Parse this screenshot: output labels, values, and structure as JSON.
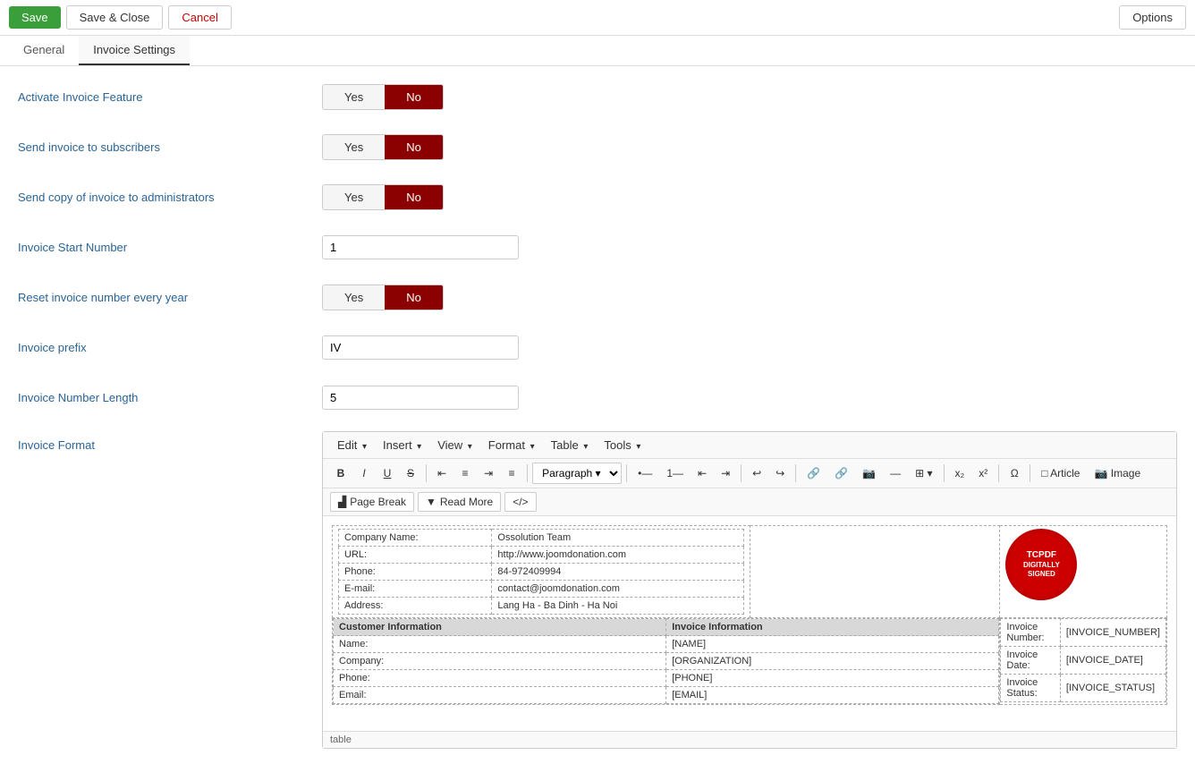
{
  "topbar": {
    "save_label": "Save",
    "save_close_label": "Save & Close",
    "cancel_label": "Cancel",
    "options_label": "Options"
  },
  "tabs": [
    {
      "id": "general",
      "label": "General"
    },
    {
      "id": "invoice_settings",
      "label": "Invoice Settings",
      "active": true
    }
  ],
  "fields": {
    "activate_invoice": {
      "label": "Activate Invoice Feature",
      "yes": "Yes",
      "no": "No",
      "value": "no"
    },
    "send_invoice_subscribers": {
      "label": "Send invoice to subscribers",
      "yes": "Yes",
      "no": "No",
      "value": "no"
    },
    "send_copy_admin": {
      "label": "Send copy of invoice to administrators",
      "yes": "Yes",
      "no": "No",
      "value": "no"
    },
    "invoice_start_number": {
      "label": "Invoice Start Number",
      "value": "1"
    },
    "reset_invoice_number": {
      "label": "Reset invoice number every year",
      "yes": "Yes",
      "no": "No",
      "value": "no"
    },
    "invoice_prefix": {
      "label": "Invoice prefix",
      "value": "IV"
    },
    "invoice_number_length": {
      "label": "Invoice Number Length",
      "value": "5"
    },
    "invoice_format": {
      "label": "Invoice Format"
    }
  },
  "editor": {
    "menus": [
      "Edit",
      "Insert",
      "View",
      "Format",
      "Table",
      "Tools"
    ],
    "toolbar": {
      "bold": "B",
      "italic": "I",
      "underline": "U",
      "strikethrough": "S",
      "align_left": "≡",
      "align_center": "≡",
      "align_right": "≡",
      "align_justify": "≡",
      "paragraph_label": "Paragraph",
      "bullet_list": "•",
      "numbered_list": "#",
      "decrease_indent": "◁",
      "increase_indent": "▷",
      "undo": "↩",
      "redo": "↪",
      "link": "🔗",
      "unlink": "🔗",
      "image": "🖼",
      "hr": "—",
      "table_icon": "⊞",
      "subscript": "x₂",
      "superscript": "x²",
      "special_char": "Ω",
      "article_label": "Article",
      "image_label": "Image"
    },
    "toolbar2": {
      "page_break_label": "Page Break",
      "read_more_label": "Read More",
      "source_label": "</>"
    },
    "invoice_content": {
      "company_name_label": "Company Name:",
      "company_name_value": "Ossolution Team",
      "url_label": "URL:",
      "url_value": "http://www.joomdonation.com",
      "phone_label": "Phone:",
      "phone_value": "84-972409994",
      "email_label": "E-mail:",
      "email_value": "contact@joomdonation.com",
      "address_label": "Address:",
      "address_value": "Lang Ha - Ba Dinh - Ha Noi",
      "logo_line1": "TCPDF",
      "logo_line2": "DIGITALLY",
      "logo_line3": "SIGNED",
      "customer_info_header": "Customer Information",
      "invoice_info_header": "Invoice Information",
      "name_label": "Name:",
      "name_value": "[NAME]",
      "company_label": "Company:",
      "company_value": "[ORGANIZATION]",
      "cust_phone_label": "Phone:",
      "cust_phone_value": "[PHONE]",
      "cust_email_label": "Email:",
      "cust_email_value": "[EMAIL]",
      "invoice_number_label": "Invoice Number:",
      "invoice_number_value": "[INVOICE_NUMBER]",
      "invoice_date_label": "Invoice Date:",
      "invoice_date_value": "[INVOICE_DATE]",
      "invoice_status_label": "Invoice Status:",
      "invoice_status_value": "[INVOICE_STATUS]"
    },
    "footer_text": "table"
  }
}
